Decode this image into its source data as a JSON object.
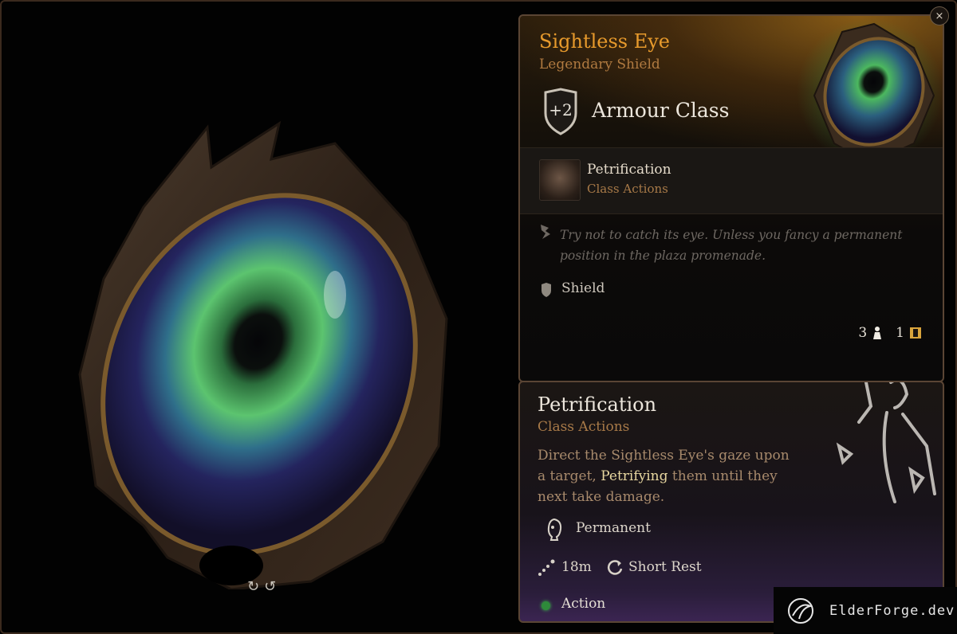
{
  "item": {
    "name": "Sightless Eye",
    "type": "Legendary Shield",
    "armour_value": "+2",
    "armour_label": "Armour Class",
    "passive": {
      "name": "Petrification",
      "subtitle": "Class Actions"
    },
    "flavor": "Try not to catch its eye. Unless you fancy a permanent position in the plaza promenade.",
    "proficiency": "Shield",
    "weight": "3",
    "value": "1"
  },
  "action": {
    "name": "Petrification",
    "subtitle": "Class Actions",
    "desc_before": "Direct the Sightless Eye's gaze upon a target, ",
    "desc_highlight": "Petrifying",
    "desc_after": " them until they next take damage.",
    "duration": "Permanent",
    "range": "18m",
    "recharge": "Short Rest",
    "cost": "Action",
    "cost_color": "#2e8a3a"
  },
  "controls": {
    "rotate_left": "↻",
    "rotate_right": "↺",
    "close": "×"
  },
  "watermark": {
    "text": "ElderForge.dev"
  },
  "colors": {
    "legendary": "#e79a2c",
    "subtitle": "#a87a48",
    "border": "#5a4534"
  },
  "icons": [
    "shield-badge-icon",
    "petrification-icon",
    "flavor-icon",
    "shield-icon",
    "weight-icon",
    "gold-icon",
    "duration-icon",
    "range-icon",
    "short-rest-icon",
    "action-dot-icon"
  ]
}
